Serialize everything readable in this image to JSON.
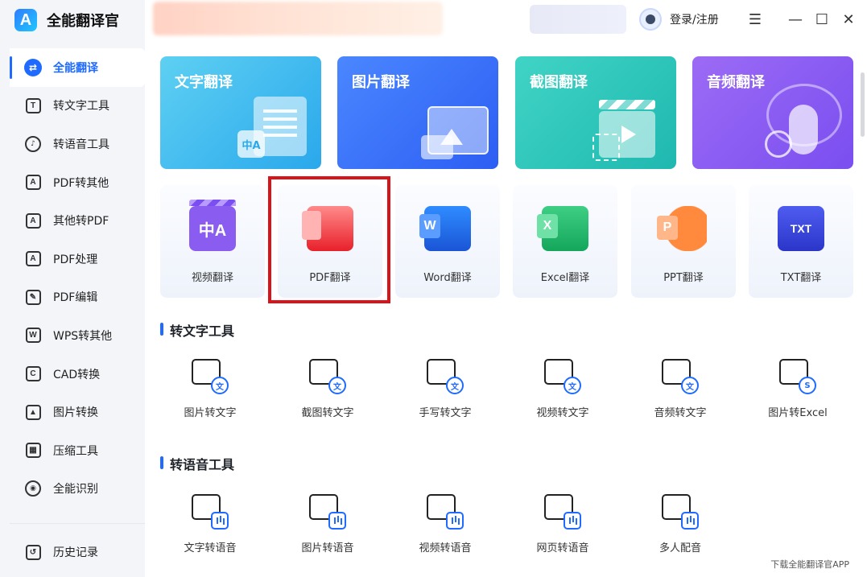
{
  "app": {
    "title": "全能翻译官",
    "logo_letter": "A"
  },
  "header": {
    "login_label": "登录/注册"
  },
  "window_controls": {
    "menu": "☰",
    "minimize": "—",
    "maximize": "☐",
    "close": "✕"
  },
  "sidebar": {
    "items": [
      {
        "label": "全能翻译",
        "icon": "translate-icon",
        "glyph": "⇄"
      },
      {
        "label": "转文字工具",
        "icon": "text-tool-icon",
        "glyph": "T"
      },
      {
        "label": "转语音工具",
        "icon": "voice-tool-icon",
        "glyph": "♪"
      },
      {
        "label": "PDF转其他",
        "icon": "pdf-convert-icon",
        "glyph": "A"
      },
      {
        "label": "其他转PDF",
        "icon": "to-pdf-icon",
        "glyph": "A"
      },
      {
        "label": "PDF处理",
        "icon": "pdf-process-icon",
        "glyph": "A"
      },
      {
        "label": "PDF编辑",
        "icon": "pdf-edit-icon",
        "glyph": "✎"
      },
      {
        "label": "WPS转其他",
        "icon": "wps-icon",
        "glyph": "W"
      },
      {
        "label": "CAD转换",
        "icon": "cad-icon",
        "glyph": "C"
      },
      {
        "label": "图片转换",
        "icon": "image-convert-icon",
        "glyph": "▲"
      },
      {
        "label": "压缩工具",
        "icon": "compress-icon",
        "glyph": "▦"
      },
      {
        "label": "全能识别",
        "icon": "recognize-icon",
        "glyph": "◉"
      }
    ],
    "history_label": "历史记录"
  },
  "main": {
    "big_cards": [
      {
        "label": "文字翻译",
        "badge": "中A"
      },
      {
        "label": "图片翻译"
      },
      {
        "label": "截图翻译"
      },
      {
        "label": "音频翻译"
      }
    ],
    "small_cards": [
      {
        "label": "视频翻译",
        "glyph": "中A"
      },
      {
        "label": "PDF翻译",
        "glyph": ""
      },
      {
        "label": "Word翻译",
        "glyph": ""
      },
      {
        "label": "Excel翻译",
        "glyph": ""
      },
      {
        "label": "PPT翻译",
        "glyph": ""
      },
      {
        "label": "TXT翻译",
        "glyph": "TXT"
      }
    ],
    "section_text": {
      "title": "转文字工具",
      "tools": [
        "图片转文字",
        "截图转文字",
        "手写转文字",
        "视频转文字",
        "音频转文字",
        "图片转Excel"
      ],
      "badges": [
        "文",
        "文",
        "文",
        "文",
        "文",
        "S"
      ]
    },
    "section_voice": {
      "title": "转语音工具",
      "tools": [
        "文字转语音",
        "图片转语音",
        "视频转语音",
        "网页转语音",
        "多人配音"
      ]
    },
    "footer_link": "下载全能翻译官APP"
  }
}
